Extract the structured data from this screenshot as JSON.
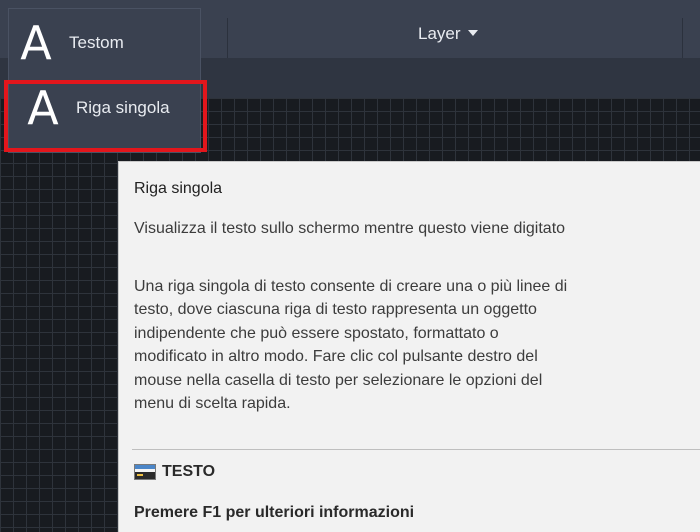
{
  "toolbar": {
    "layer_label": "Layer",
    "layer_caret_icon": "caret-down-icon"
  },
  "menu": {
    "items": [
      {
        "label": "Testom",
        "icon": "text-a-icon"
      },
      {
        "label": "Riga singola",
        "icon": "text-a-icon",
        "highlighted": true
      }
    ]
  },
  "tooltip": {
    "title": "Riga singola",
    "subtitle": "Visualizza il testo sullo schermo mentre questo viene digitato",
    "description_lines": [
      "Una riga singola di testo consente di creare una o più linee di",
      "testo, dove ciascuna riga di testo rappresenta un oggetto",
      "indipendente che può essere spostato, formattato o",
      "modificato in altro modo. Fare clic col pulsante destro del",
      "mouse nella casella di testo per selezionare le opzioni del",
      "menu di scelta rapida."
    ],
    "command": "TESTO",
    "command_icon": "command-window-icon",
    "help": "Premere F1 per ulteriori informazioni"
  },
  "colors": {
    "toolbar_bg": "#3a4150",
    "canvas_bg": "#181b20",
    "highlight": "#e3161c",
    "tooltip_bg": "#f2f2f2"
  }
}
